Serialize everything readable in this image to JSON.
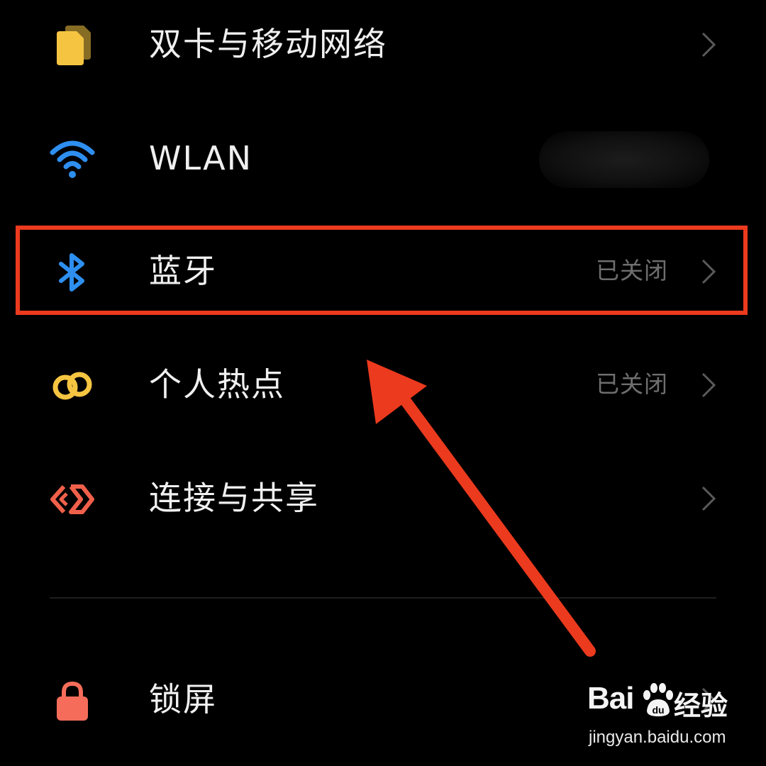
{
  "settings": {
    "items": [
      {
        "label": "双卡与移动网络",
        "status": "",
        "icon": "sim-card-icon"
      },
      {
        "label": "WLAN",
        "status": "",
        "icon": "wifi-icon"
      },
      {
        "label": "蓝牙",
        "status": "已关闭",
        "icon": "bluetooth-icon"
      },
      {
        "label": "个人热点",
        "status": "已关闭",
        "icon": "hotspot-icon"
      },
      {
        "label": "连接与共享",
        "status": "",
        "icon": "connection-share-icon"
      },
      {
        "label": "锁屏",
        "status": "",
        "icon": "lock-icon"
      }
    ]
  },
  "colors": {
    "background": "#000000",
    "highlight": "#ec3a1e",
    "sim_icon": "#f5c542",
    "wifi_icon": "#2e8ff0",
    "bluetooth_icon": "#2e8ff0",
    "hotspot_icon": "#f5c542",
    "share_icon": "#f0604a",
    "lock_icon": "#f56d5a",
    "status_text": "#6e6e6e"
  },
  "watermark": {
    "brand_left": "Bai",
    "brand_right": "经验",
    "url": "jingyan.baidu.com"
  }
}
